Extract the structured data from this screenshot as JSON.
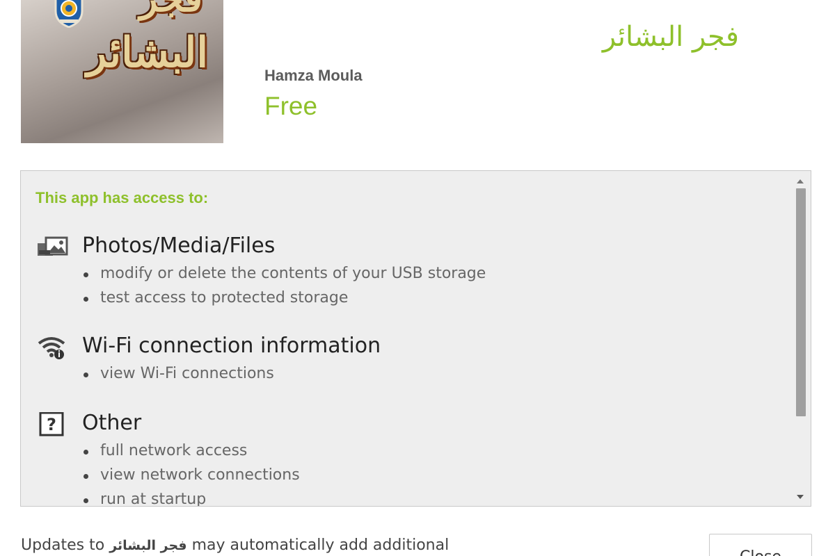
{
  "app": {
    "title": "فجر البشائر",
    "developer": "Hamza Moula",
    "price": "Free",
    "icon_text_top": "فجر",
    "icon_text_main": "البشائر",
    "icon_text": "فجر البشائر"
  },
  "permissions": {
    "heading": "This app has access to:",
    "groups": [
      {
        "icon": "photo-media-icon",
        "title": "Photos/Media/Files",
        "items": [
          "modify or delete the contents of your USB storage",
          "test access to protected storage"
        ]
      },
      {
        "icon": "wifi-info-icon",
        "title": "Wi-Fi connection information",
        "items": [
          "view Wi-Fi connections"
        ]
      },
      {
        "icon": "question-mark-icon",
        "title": "Other",
        "items": [
          "full network access",
          "view network connections",
          "run at startup"
        ]
      }
    ]
  },
  "footer": {
    "text_before": "Updates to",
    "app_name": "فجر البشائر",
    "text_after": "may automatically add additional",
    "close_label": "Close"
  },
  "colors": {
    "accent": "#8ec02b",
    "panel_bg": "#eeeeee",
    "body_text": "#666666"
  }
}
